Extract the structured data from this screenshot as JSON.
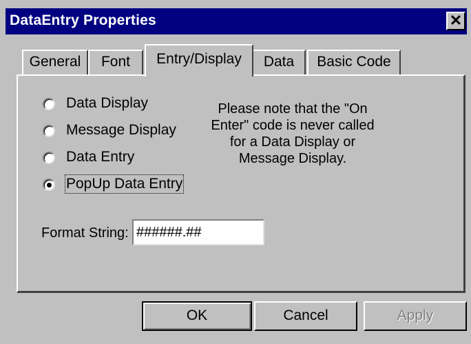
{
  "window": {
    "title": "DataEntry Properties",
    "close_glyph": "✕"
  },
  "tabs": [
    {
      "label": "General",
      "active": false
    },
    {
      "label": "Font",
      "active": false
    },
    {
      "label": "Entry/Display",
      "active": true
    },
    {
      "label": "Data",
      "active": false
    },
    {
      "label": "Basic Code",
      "active": false
    }
  ],
  "mode_options": [
    {
      "label": "Data Display",
      "selected": false
    },
    {
      "label": "Message Display",
      "selected": false
    },
    {
      "label": "Data Entry",
      "selected": false
    },
    {
      "label": "PopUp Data Entry",
      "selected": true
    }
  ],
  "note": "Please note that the \"On Enter\" code is never called for a Data Display or Message Display.",
  "format": {
    "label": "Format String:",
    "value": "######.##"
  },
  "buttons": {
    "ok": "OK",
    "cancel": "Cancel",
    "apply": "Apply"
  }
}
